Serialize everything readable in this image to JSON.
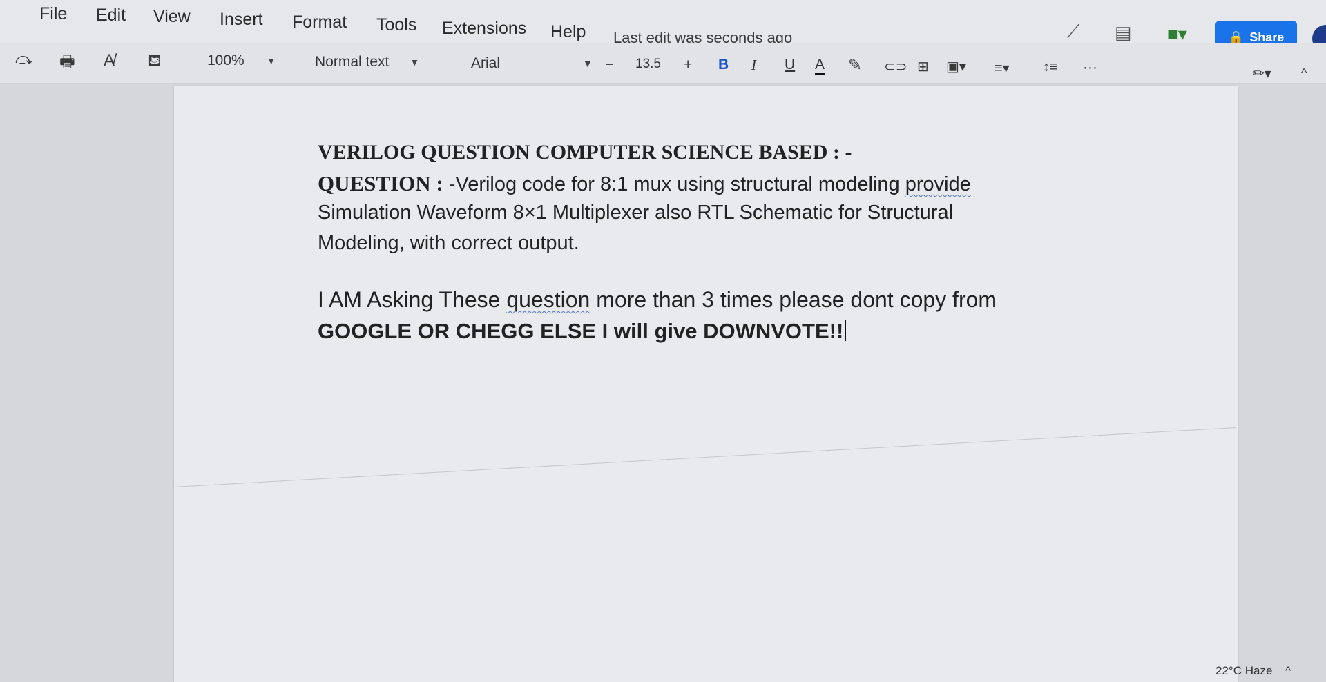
{
  "menu": {
    "items": [
      "File",
      "Edit",
      "View",
      "Insert",
      "Format",
      "Tools",
      "Extensions",
      "Help"
    ],
    "last_edit": "Last edit was seconds ago",
    "share_label": "Share"
  },
  "toolbar": {
    "zoom": "100%",
    "style": "Normal text",
    "font": "Arial",
    "font_size_minus": "−",
    "font_size": "13.5",
    "font_size_plus": "+",
    "bold": "B",
    "italic": "I",
    "underline": "U",
    "text_color": "A",
    "more": "···"
  },
  "document": {
    "heading": "VERILOG QUESTION COMPUTER SCIENCE  BASED : -",
    "question_label": "QUESTION  :",
    "line1_rest_a": " -Verilog  code  for  8:1  mux  using  structural  modeling ",
    "line1_word": "provide",
    "line2": "Simulation  Waveform  8×1  Multiplexer  also  RTL  Schematic  for  Structural",
    "line3": "Modeling, with correct output.",
    "line4_a": "I  AM  Asking  These  ",
    "line4_word": "question",
    "line4_b": "  more  than  3  times  please  dont  copy  from",
    "line5": "GOOGLE OR CHEGG ELSE I will give DOWNVOTE!!"
  },
  "tray": {
    "weather": "22°C  Haze",
    "chevron": "^"
  },
  "colors": {
    "share_button": "#1a73e8",
    "page": "#e9eaed",
    "background": "#d6d7da"
  }
}
